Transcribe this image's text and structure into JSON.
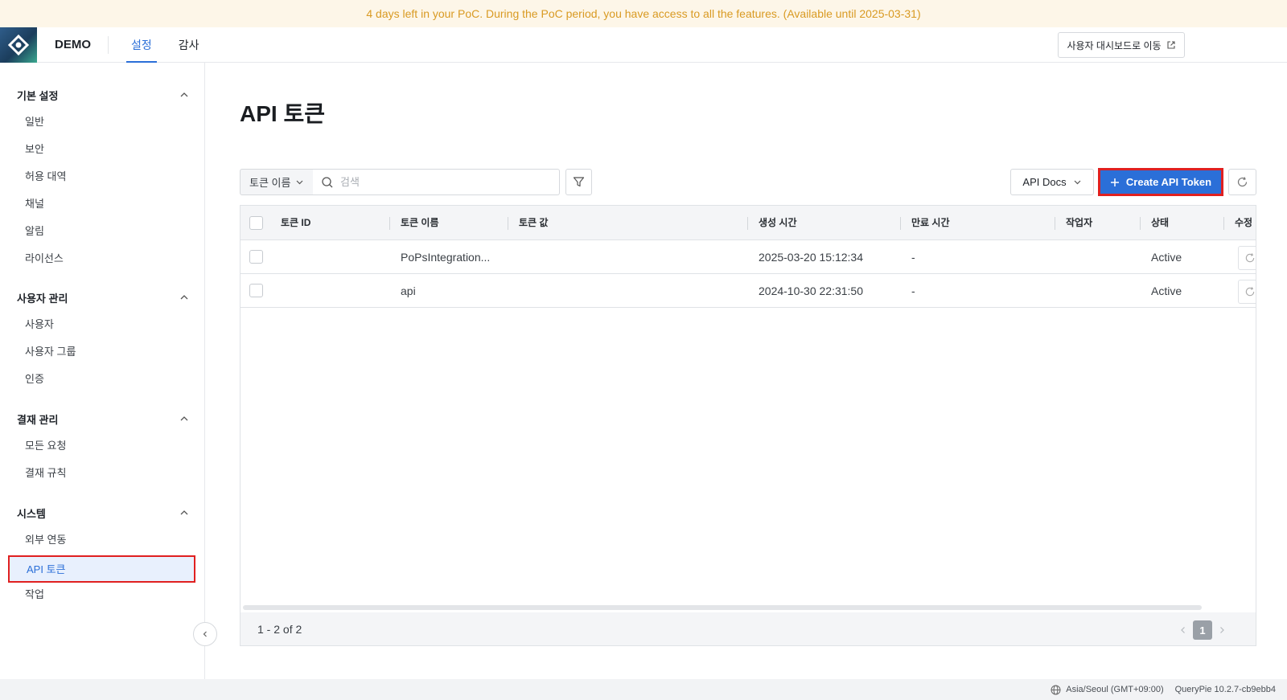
{
  "banner": {
    "text": "4 days left in your PoC. During the PoC period, you have access to all the features. (Available until 2025-03-31)"
  },
  "header": {
    "brand": "DEMO",
    "tabs": [
      {
        "label": "설정",
        "active": true
      },
      {
        "label": "감사",
        "active": false
      }
    ],
    "dashboard_button": "사용자 대시보드로 이동"
  },
  "sidebar": {
    "sections": [
      {
        "title": "기본 설정",
        "items": [
          "일반",
          "보안",
          "허용 대역",
          "채널",
          "알림",
          "라이선스"
        ]
      },
      {
        "title": "사용자 관리",
        "items": [
          "사용자",
          "사용자 그룹",
          "인증"
        ]
      },
      {
        "title": "결재 관리",
        "items": [
          "모든 요청",
          "결재 규칙"
        ]
      },
      {
        "title": "시스템",
        "items": [
          "외부 연동",
          "API 토큰",
          "작업"
        ]
      }
    ],
    "selected": "API 토큰"
  },
  "main": {
    "title": "API 토큰",
    "toolbar": {
      "field_select": "토큰 이름",
      "search_placeholder": "검색",
      "docs_button": "API Docs",
      "create_button": "Create API Token"
    },
    "table": {
      "columns": [
        "토큰 ID",
        "토큰 이름",
        "토큰 값",
        "생성 시간",
        "만료 시간",
        "작업자",
        "상태",
        "수정"
      ],
      "rows": [
        {
          "token_id": "",
          "name": "PoPsIntegration...",
          "value": "",
          "created": "2025-03-20 15:12:34",
          "expires": "-",
          "operator": "",
          "status": "Active"
        },
        {
          "token_id": "",
          "name": "api",
          "value": "",
          "created": "2024-10-30 22:31:50",
          "expires": "-",
          "operator": "",
          "status": "Active"
        }
      ]
    },
    "pagination": {
      "range": "1 - 2 of 2",
      "current_page": "1"
    }
  },
  "statusbar": {
    "timezone": "Asia/Seoul (GMT+09:00)",
    "version": "QueryPie 10.2.7-cb9ebb4"
  },
  "colors": {
    "primary": "#2b6fd8",
    "banner_text": "#d99a22",
    "banner_bg": "#fdf6e8",
    "highlight": "#e02020"
  }
}
